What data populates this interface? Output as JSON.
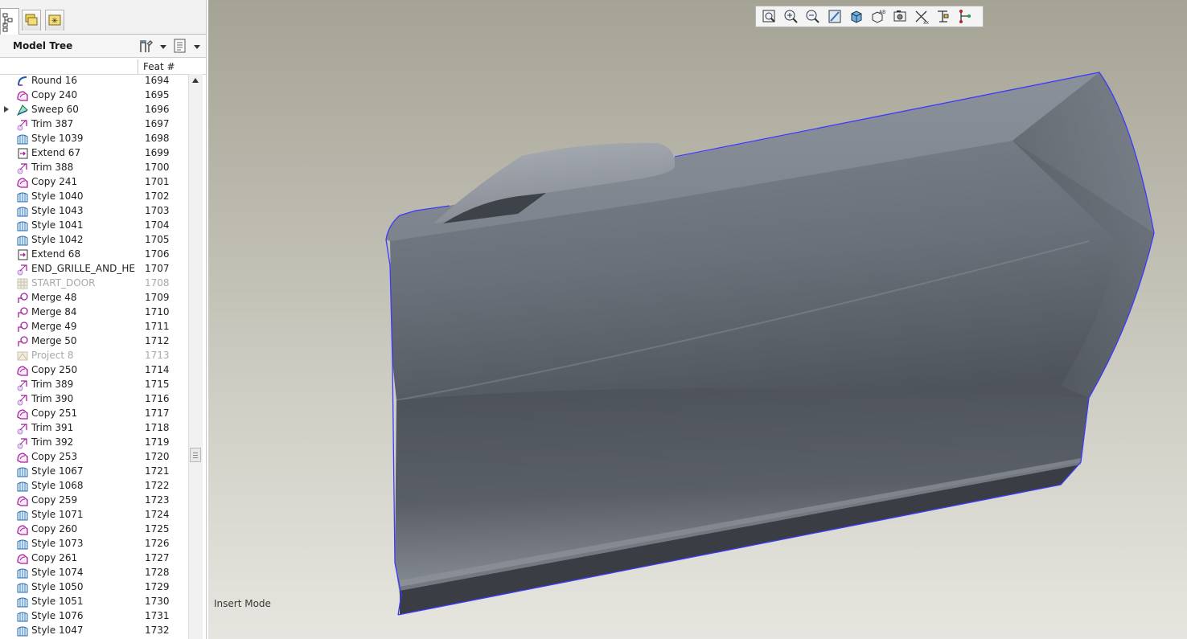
{
  "panel": {
    "title": "Model Tree",
    "column_header": "Feat #",
    "tabs": [
      {
        "icon": "model-tree-tab-icon"
      },
      {
        "icon": "folder-browser-tab-icon"
      },
      {
        "icon": "favorites-tab-icon"
      }
    ],
    "header_buttons": [
      {
        "icon": "tree-tools-icon"
      },
      {
        "icon": "tree-settings-icon"
      }
    ]
  },
  "tree": {
    "items": [
      {
        "name": "Round 16",
        "feat": "1694",
        "type": "round",
        "dim": false,
        "expandable": false
      },
      {
        "name": "Copy 240",
        "feat": "1695",
        "type": "copy",
        "dim": false,
        "expandable": false
      },
      {
        "name": "Sweep 60",
        "feat": "1696",
        "type": "sweep",
        "dim": false,
        "expandable": true
      },
      {
        "name": "Trim 387",
        "feat": "1697",
        "type": "trim",
        "dim": false,
        "expandable": false
      },
      {
        "name": "Style 1039",
        "feat": "1698",
        "type": "style",
        "dim": false,
        "expandable": false
      },
      {
        "name": "Extend 67",
        "feat": "1699",
        "type": "extend",
        "dim": false,
        "expandable": false
      },
      {
        "name": "Trim 388",
        "feat": "1700",
        "type": "trim",
        "dim": false,
        "expandable": false
      },
      {
        "name": "Copy 241",
        "feat": "1701",
        "type": "copy",
        "dim": false,
        "expandable": false
      },
      {
        "name": "Style 1040",
        "feat": "1702",
        "type": "style",
        "dim": false,
        "expandable": false
      },
      {
        "name": "Style 1043",
        "feat": "1703",
        "type": "style",
        "dim": false,
        "expandable": false
      },
      {
        "name": "Style 1041",
        "feat": "1704",
        "type": "style",
        "dim": false,
        "expandable": false
      },
      {
        "name": "Style 1042",
        "feat": "1705",
        "type": "style",
        "dim": false,
        "expandable": false
      },
      {
        "name": "Extend 68",
        "feat": "1706",
        "type": "extend",
        "dim": false,
        "expandable": false
      },
      {
        "name": "END_GRILLE_AND_HE",
        "feat": "1707",
        "type": "trim",
        "dim": false,
        "expandable": false
      },
      {
        "name": "START_DOOR",
        "feat": "1708",
        "type": "layer",
        "dim": true,
        "expandable": false
      },
      {
        "name": "Merge 48",
        "feat": "1709",
        "type": "merge",
        "dim": false,
        "expandable": false
      },
      {
        "name": "Merge 84",
        "feat": "1710",
        "type": "merge",
        "dim": false,
        "expandable": false
      },
      {
        "name": "Merge 49",
        "feat": "1711",
        "type": "merge",
        "dim": false,
        "expandable": false
      },
      {
        "name": "Merge 50",
        "feat": "1712",
        "type": "merge",
        "dim": false,
        "expandable": false
      },
      {
        "name": "Project 8",
        "feat": "1713",
        "type": "project",
        "dim": true,
        "expandable": false
      },
      {
        "name": "Copy 250",
        "feat": "1714",
        "type": "copy",
        "dim": false,
        "expandable": false
      },
      {
        "name": "Trim 389",
        "feat": "1715",
        "type": "trim",
        "dim": false,
        "expandable": false
      },
      {
        "name": "Trim 390",
        "feat": "1716",
        "type": "trim",
        "dim": false,
        "expandable": false
      },
      {
        "name": "Copy 251",
        "feat": "1717",
        "type": "copy",
        "dim": false,
        "expandable": false
      },
      {
        "name": "Trim 391",
        "feat": "1718",
        "type": "trim",
        "dim": false,
        "expandable": false
      },
      {
        "name": "Trim 392",
        "feat": "1719",
        "type": "trim",
        "dim": false,
        "expandable": false
      },
      {
        "name": "Copy 253",
        "feat": "1720",
        "type": "copy",
        "dim": false,
        "expandable": false
      },
      {
        "name": "Style 1067",
        "feat": "1721",
        "type": "style",
        "dim": false,
        "expandable": false
      },
      {
        "name": "Style 1068",
        "feat": "1722",
        "type": "style",
        "dim": false,
        "expandable": false
      },
      {
        "name": "Copy 259",
        "feat": "1723",
        "type": "copy",
        "dim": false,
        "expandable": false
      },
      {
        "name": "Style 1071",
        "feat": "1724",
        "type": "style",
        "dim": false,
        "expandable": false
      },
      {
        "name": "Copy 260",
        "feat": "1725",
        "type": "copy",
        "dim": false,
        "expandable": false
      },
      {
        "name": "Style 1073",
        "feat": "1726",
        "type": "style",
        "dim": false,
        "expandable": false
      },
      {
        "name": "Copy 261",
        "feat": "1727",
        "type": "copy",
        "dim": false,
        "expandable": false
      },
      {
        "name": "Style 1074",
        "feat": "1728",
        "type": "style",
        "dim": false,
        "expandable": false
      },
      {
        "name": "Style 1050",
        "feat": "1729",
        "type": "style",
        "dim": false,
        "expandable": false
      },
      {
        "name": "Style 1051",
        "feat": "1730",
        "type": "style",
        "dim": false,
        "expandable": false
      },
      {
        "name": "Style 1076",
        "feat": "1731",
        "type": "style",
        "dim": false,
        "expandable": false
      },
      {
        "name": "Style 1047",
        "feat": "1732",
        "type": "style",
        "dim": false,
        "expandable": false
      }
    ]
  },
  "view_toolbar": {
    "buttons": [
      {
        "icon": "refit-icon"
      },
      {
        "icon": "zoom-in-icon"
      },
      {
        "icon": "zoom-out-icon"
      },
      {
        "icon": "repaint-icon"
      },
      {
        "icon": "display-style-icon"
      },
      {
        "icon": "saved-orientations-icon"
      },
      {
        "icon": "view-manager-icon"
      },
      {
        "icon": "datum-display-icon"
      },
      {
        "icon": "annotation-display-icon"
      },
      {
        "icon": "spin-center-icon"
      }
    ]
  },
  "viewport": {
    "status_text": "Insert Mode",
    "edge_highlight_color": "#3a3aff"
  }
}
